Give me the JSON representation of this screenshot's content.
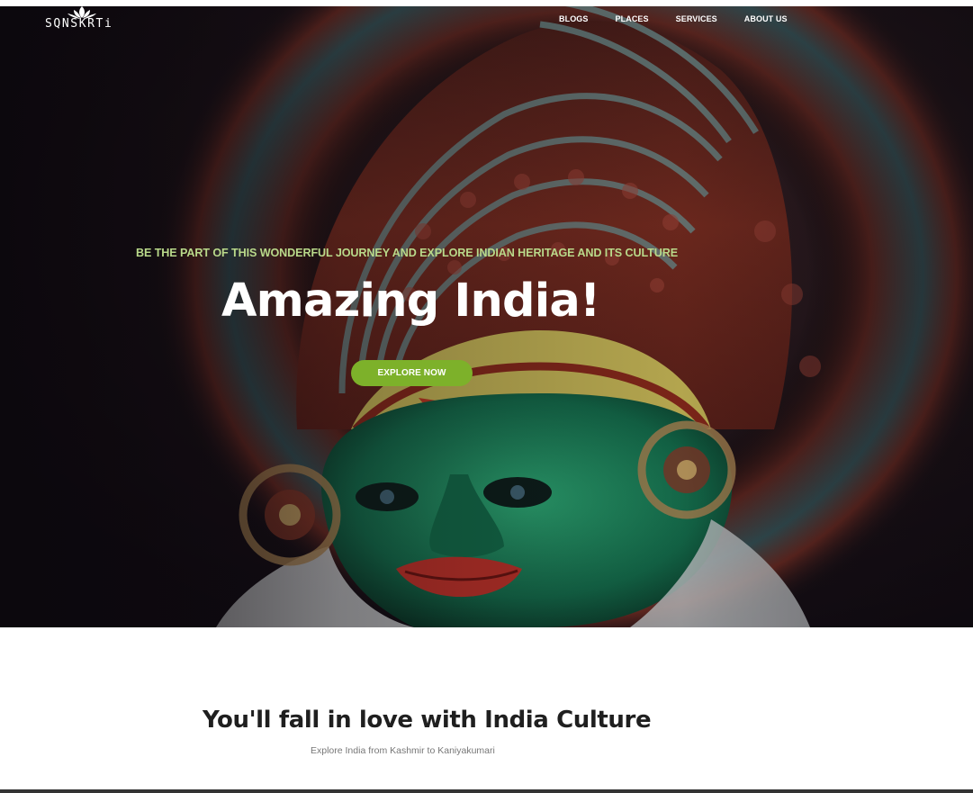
{
  "brand": {
    "name": "SQNSKRTi",
    "logo_icon": "lotus-icon"
  },
  "nav": {
    "items": [
      {
        "label": "BLOGS"
      },
      {
        "label": "PLACES"
      },
      {
        "label": "SERVICES"
      },
      {
        "label": "ABOUT US"
      }
    ]
  },
  "hero": {
    "tagline": "BE THE PART OF THIS WONDERFUL JOURNEY AND EXPLORE INDIAN HERITAGE AND ITS CULTURE",
    "title": "Amazing India!",
    "cta_label": "EXPLORE NOW"
  },
  "intro": {
    "title": "You'll fall in love with India Culture",
    "subtitle": "Explore India from Kashmir to Kaniyakumari"
  },
  "colors": {
    "accent": "#7db12a",
    "tagline": "#b9d98a",
    "hero_background": "#160f18",
    "heading_text": "#1f1f1f"
  }
}
